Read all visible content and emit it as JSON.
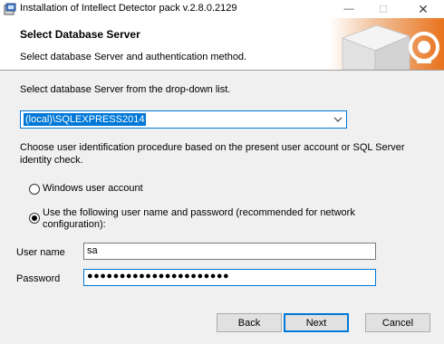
{
  "window": {
    "title": "Installation of Intellect Detector pack v.2.8.0.2129",
    "minimize_glyph": "—",
    "maximize_glyph": "☐",
    "close_glyph": "✕"
  },
  "banner": {
    "title": "Select Database Server",
    "subtitle": "Select database Server and authentication method."
  },
  "server": {
    "prompt": "Select database Server from the drop-down list.",
    "selected": "(local)\\SQLEXPRESS2014"
  },
  "auth": {
    "prompt_line1": "Choose user identification procedure based on the present user account or SQL Server",
    "prompt_line2": "identity check.",
    "option_windows": "Windows user account",
    "option_sql_line1": "Use the following user name and password (recommended for network",
    "option_sql_line2": "configuration):",
    "selected": "sql"
  },
  "credentials": {
    "username_label": "User name",
    "username_value": "sa",
    "password_label": "Password",
    "password_value": "●●●●●●●●●●●●●●●●●●●●●●"
  },
  "buttons": {
    "back": "Back",
    "next": "Next",
    "cancel": "Cancel"
  },
  "colors": {
    "accent": "#0078d7",
    "dialog_bg": "#f0f0f0",
    "banner_art": "#e8721c"
  }
}
